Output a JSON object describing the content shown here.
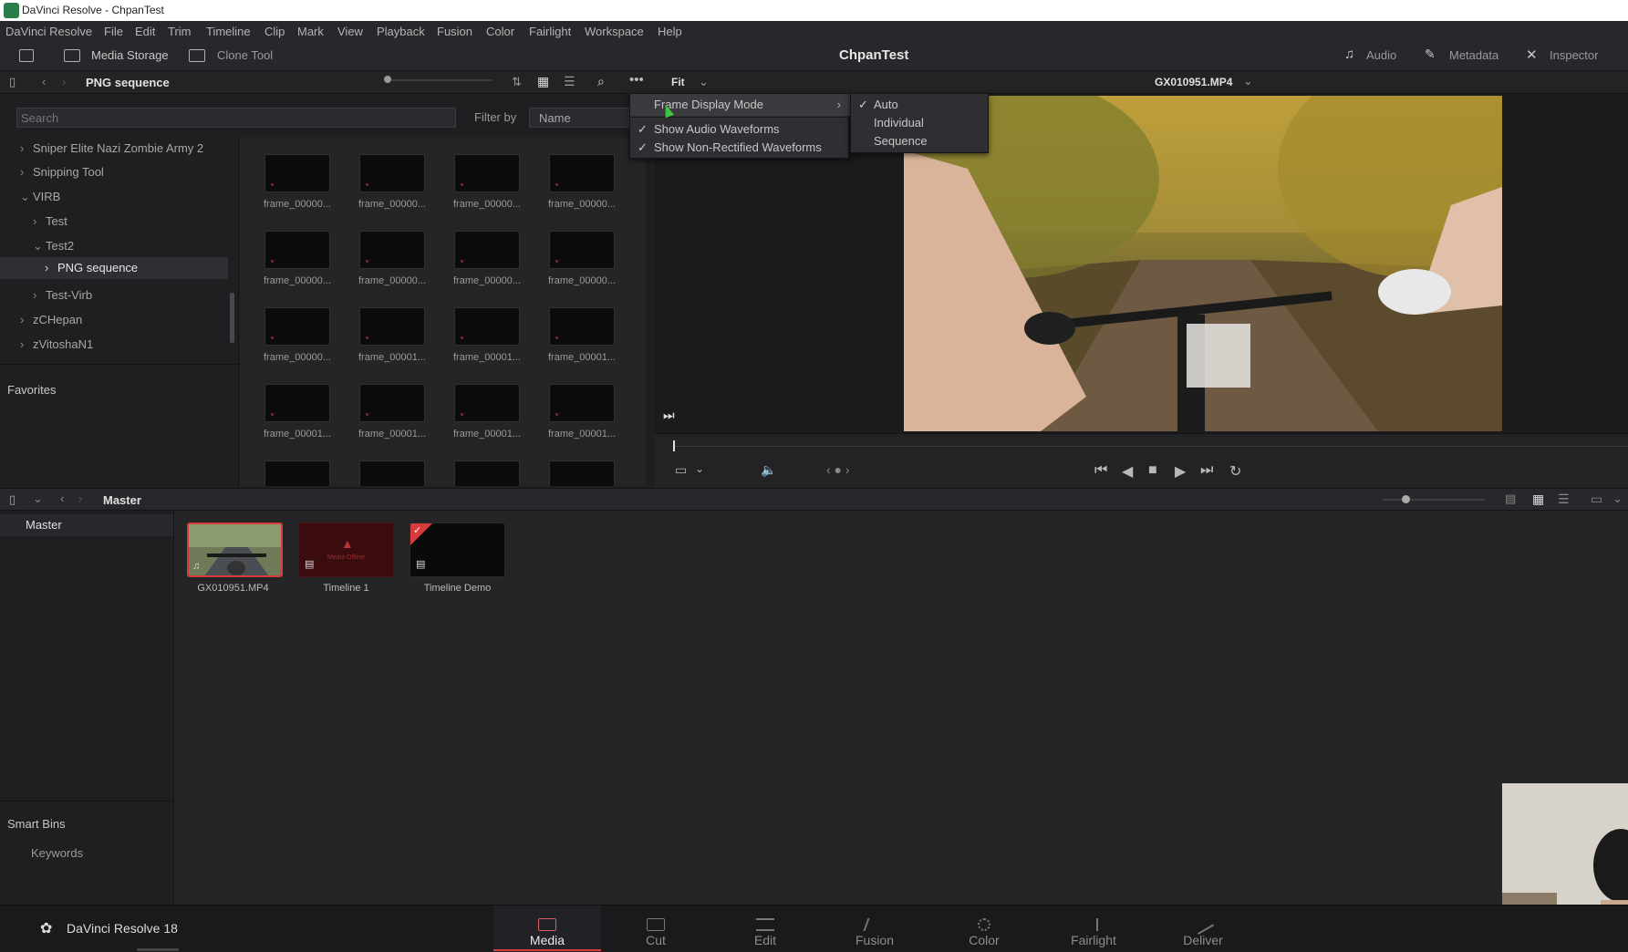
{
  "window": {
    "title": "DaVinci Resolve - ChpanTest"
  },
  "menu": [
    "DaVinci Resolve",
    "File",
    "Edit",
    "Trim",
    "Timeline",
    "Clip",
    "Mark",
    "View",
    "Playback",
    "Fusion",
    "Color",
    "Fairlight",
    "Workspace",
    "Help"
  ],
  "toolbar": {
    "media_storage": "Media Storage",
    "clone_tool": "Clone Tool",
    "project_name": "ChpanTest",
    "audio": "Audio",
    "metadata": "Metadata",
    "inspector": "Inspector"
  },
  "storage": {
    "path": "PNG sequence",
    "search_placeholder": "Search",
    "filter_label": "Filter by",
    "filter_value": "Name",
    "zoom_label": "Fit",
    "clip_name": "GX010951.MP4"
  },
  "folder_tree": [
    {
      "label": "Sniper Elite  Nazi Zombie Army 2",
      "depth": 0,
      "expanded": false
    },
    {
      "label": "Snipping Tool",
      "depth": 0,
      "expanded": false
    },
    {
      "label": "VIRB",
      "depth": 0,
      "expanded": true
    },
    {
      "label": "Test",
      "depth": 1,
      "expanded": false
    },
    {
      "label": "Test2",
      "depth": 1,
      "expanded": true
    },
    {
      "label": "PNG sequence",
      "depth": 2,
      "expanded": false,
      "selected": true
    },
    {
      "label": "Test-Virb",
      "depth": 1,
      "expanded": false
    },
    {
      "label": "zCHepan",
      "depth": 0,
      "expanded": false
    },
    {
      "label": "zVitoshaN1",
      "depth": 0,
      "expanded": false
    }
  ],
  "favorites_label": "Favorites",
  "thumbnails": [
    "frame_00000...",
    "frame_00000...",
    "frame_00000...",
    "frame_00000...",
    "frame_00000...",
    "frame_00000...",
    "frame_00000...",
    "frame_00000...",
    "frame_00000...",
    "frame_00001...",
    "frame_00001...",
    "frame_00001...",
    "frame_00001...",
    "frame_00001...",
    "frame_00001...",
    "frame_00001..."
  ],
  "context_menu": {
    "items": [
      {
        "label": "Frame Display Mode",
        "checked": false,
        "submenu": true,
        "highlighted": true
      },
      {
        "label": "Show Audio Waveforms",
        "checked": true
      },
      {
        "label": "Show Non-Rectified Waveforms",
        "checked": true
      }
    ],
    "submenu": [
      {
        "label": "Auto",
        "checked": true
      },
      {
        "label": "Individual",
        "checked": false
      },
      {
        "label": "Sequence",
        "checked": false
      }
    ]
  },
  "media_pool": {
    "path": "Master",
    "sidebar_master": "Master",
    "smart_bins": "Smart Bins",
    "keywords": "Keywords",
    "clips": [
      {
        "name": "GX010951.MP4",
        "selected": true
      },
      {
        "name": "Timeline 1",
        "offline_text": "Media Offline"
      },
      {
        "name": "Timeline Demo"
      }
    ]
  },
  "pagebar": {
    "brand": "DaVinci Resolve 18",
    "pages": [
      "Media",
      "Cut",
      "Edit",
      "Fusion",
      "Color",
      "Fairlight",
      "Deliver"
    ],
    "active": "Media"
  },
  "colors": {
    "accent": "#d93a3a",
    "panel": "#1f1f22",
    "toolbar": "#28282c"
  }
}
